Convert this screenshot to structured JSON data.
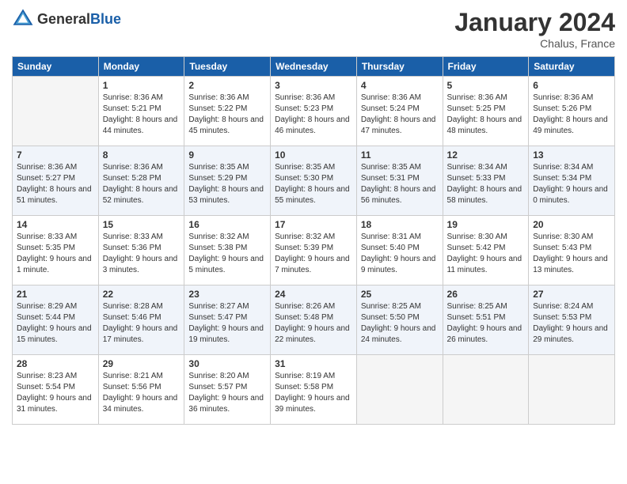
{
  "header": {
    "logo_general": "General",
    "logo_blue": "Blue",
    "month": "January 2024",
    "location": "Chalus, France"
  },
  "days_of_week": [
    "Sunday",
    "Monday",
    "Tuesday",
    "Wednesday",
    "Thursday",
    "Friday",
    "Saturday"
  ],
  "weeks": [
    [
      {
        "day": "",
        "sunrise": "",
        "sunset": "",
        "daylight": ""
      },
      {
        "day": "1",
        "sunrise": "Sunrise: 8:36 AM",
        "sunset": "Sunset: 5:21 PM",
        "daylight": "Daylight: 8 hours and 44 minutes."
      },
      {
        "day": "2",
        "sunrise": "Sunrise: 8:36 AM",
        "sunset": "Sunset: 5:22 PM",
        "daylight": "Daylight: 8 hours and 45 minutes."
      },
      {
        "day": "3",
        "sunrise": "Sunrise: 8:36 AM",
        "sunset": "Sunset: 5:23 PM",
        "daylight": "Daylight: 8 hours and 46 minutes."
      },
      {
        "day": "4",
        "sunrise": "Sunrise: 8:36 AM",
        "sunset": "Sunset: 5:24 PM",
        "daylight": "Daylight: 8 hours and 47 minutes."
      },
      {
        "day": "5",
        "sunrise": "Sunrise: 8:36 AM",
        "sunset": "Sunset: 5:25 PM",
        "daylight": "Daylight: 8 hours and 48 minutes."
      },
      {
        "day": "6",
        "sunrise": "Sunrise: 8:36 AM",
        "sunset": "Sunset: 5:26 PM",
        "daylight": "Daylight: 8 hours and 49 minutes."
      }
    ],
    [
      {
        "day": "7",
        "sunrise": "Sunrise: 8:36 AM",
        "sunset": "Sunset: 5:27 PM",
        "daylight": "Daylight: 8 hours and 51 minutes."
      },
      {
        "day": "8",
        "sunrise": "Sunrise: 8:36 AM",
        "sunset": "Sunset: 5:28 PM",
        "daylight": "Daylight: 8 hours and 52 minutes."
      },
      {
        "day": "9",
        "sunrise": "Sunrise: 8:35 AM",
        "sunset": "Sunset: 5:29 PM",
        "daylight": "Daylight: 8 hours and 53 minutes."
      },
      {
        "day": "10",
        "sunrise": "Sunrise: 8:35 AM",
        "sunset": "Sunset: 5:30 PM",
        "daylight": "Daylight: 8 hours and 55 minutes."
      },
      {
        "day": "11",
        "sunrise": "Sunrise: 8:35 AM",
        "sunset": "Sunset: 5:31 PM",
        "daylight": "Daylight: 8 hours and 56 minutes."
      },
      {
        "day": "12",
        "sunrise": "Sunrise: 8:34 AM",
        "sunset": "Sunset: 5:33 PM",
        "daylight": "Daylight: 8 hours and 58 minutes."
      },
      {
        "day": "13",
        "sunrise": "Sunrise: 8:34 AM",
        "sunset": "Sunset: 5:34 PM",
        "daylight": "Daylight: 9 hours and 0 minutes."
      }
    ],
    [
      {
        "day": "14",
        "sunrise": "Sunrise: 8:33 AM",
        "sunset": "Sunset: 5:35 PM",
        "daylight": "Daylight: 9 hours and 1 minute."
      },
      {
        "day": "15",
        "sunrise": "Sunrise: 8:33 AM",
        "sunset": "Sunset: 5:36 PM",
        "daylight": "Daylight: 9 hours and 3 minutes."
      },
      {
        "day": "16",
        "sunrise": "Sunrise: 8:32 AM",
        "sunset": "Sunset: 5:38 PM",
        "daylight": "Daylight: 9 hours and 5 minutes."
      },
      {
        "day": "17",
        "sunrise": "Sunrise: 8:32 AM",
        "sunset": "Sunset: 5:39 PM",
        "daylight": "Daylight: 9 hours and 7 minutes."
      },
      {
        "day": "18",
        "sunrise": "Sunrise: 8:31 AM",
        "sunset": "Sunset: 5:40 PM",
        "daylight": "Daylight: 9 hours and 9 minutes."
      },
      {
        "day": "19",
        "sunrise": "Sunrise: 8:30 AM",
        "sunset": "Sunset: 5:42 PM",
        "daylight": "Daylight: 9 hours and 11 minutes."
      },
      {
        "day": "20",
        "sunrise": "Sunrise: 8:30 AM",
        "sunset": "Sunset: 5:43 PM",
        "daylight": "Daylight: 9 hours and 13 minutes."
      }
    ],
    [
      {
        "day": "21",
        "sunrise": "Sunrise: 8:29 AM",
        "sunset": "Sunset: 5:44 PM",
        "daylight": "Daylight: 9 hours and 15 minutes."
      },
      {
        "day": "22",
        "sunrise": "Sunrise: 8:28 AM",
        "sunset": "Sunset: 5:46 PM",
        "daylight": "Daylight: 9 hours and 17 minutes."
      },
      {
        "day": "23",
        "sunrise": "Sunrise: 8:27 AM",
        "sunset": "Sunset: 5:47 PM",
        "daylight": "Daylight: 9 hours and 19 minutes."
      },
      {
        "day": "24",
        "sunrise": "Sunrise: 8:26 AM",
        "sunset": "Sunset: 5:48 PM",
        "daylight": "Daylight: 9 hours and 22 minutes."
      },
      {
        "day": "25",
        "sunrise": "Sunrise: 8:25 AM",
        "sunset": "Sunset: 5:50 PM",
        "daylight": "Daylight: 9 hours and 24 minutes."
      },
      {
        "day": "26",
        "sunrise": "Sunrise: 8:25 AM",
        "sunset": "Sunset: 5:51 PM",
        "daylight": "Daylight: 9 hours and 26 minutes."
      },
      {
        "day": "27",
        "sunrise": "Sunrise: 8:24 AM",
        "sunset": "Sunset: 5:53 PM",
        "daylight": "Daylight: 9 hours and 29 minutes."
      }
    ],
    [
      {
        "day": "28",
        "sunrise": "Sunrise: 8:23 AM",
        "sunset": "Sunset: 5:54 PM",
        "daylight": "Daylight: 9 hours and 31 minutes."
      },
      {
        "day": "29",
        "sunrise": "Sunrise: 8:21 AM",
        "sunset": "Sunset: 5:56 PM",
        "daylight": "Daylight: 9 hours and 34 minutes."
      },
      {
        "day": "30",
        "sunrise": "Sunrise: 8:20 AM",
        "sunset": "Sunset: 5:57 PM",
        "daylight": "Daylight: 9 hours and 36 minutes."
      },
      {
        "day": "31",
        "sunrise": "Sunrise: 8:19 AM",
        "sunset": "Sunset: 5:58 PM",
        "daylight": "Daylight: 9 hours and 39 minutes."
      },
      {
        "day": "",
        "sunrise": "",
        "sunset": "",
        "daylight": ""
      },
      {
        "day": "",
        "sunrise": "",
        "sunset": "",
        "daylight": ""
      },
      {
        "day": "",
        "sunrise": "",
        "sunset": "",
        "daylight": ""
      }
    ]
  ]
}
